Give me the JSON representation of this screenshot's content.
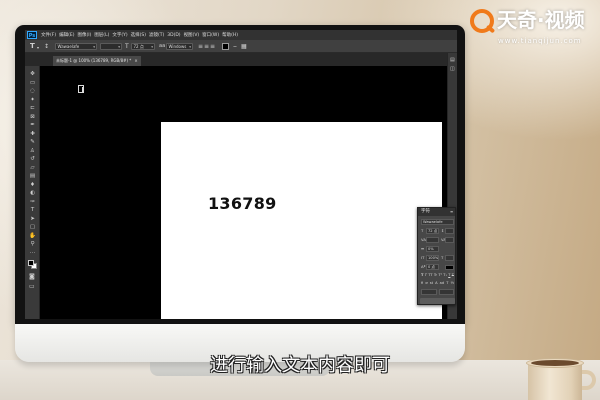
{
  "watermark": {
    "brand": "天奇·视频",
    "url": "www.tianqijun.com"
  },
  "subtitle": "进行输入文本内容即可",
  "photoshop": {
    "logo": "Ps",
    "menu": [
      "文件(F)",
      "编辑(E)",
      "图像(I)",
      "图层(L)",
      "文字(Y)",
      "选择(S)",
      "滤镜(T)",
      "3D(D)",
      "视图(V)",
      "窗口(W)",
      "帮助(H)"
    ],
    "options_bar": {
      "font_family": "Wawaelafe",
      "font_style": "",
      "font_size": "72 点",
      "antialias": "Windows",
      "text_color": "#000000"
    },
    "document_tab": {
      "title": "未标题-1 @ 100% (136789, RGB/8#) *"
    },
    "tools": [
      "move-icon",
      "marquee-icon",
      "lasso-icon",
      "quick-select-icon",
      "crop-icon",
      "frame-icon",
      "eyedropper-icon",
      "spot-healing-icon",
      "brush-icon",
      "clone-stamp-icon",
      "history-brush-icon",
      "eraser-icon",
      "gradient-icon",
      "blur-icon",
      "dodge-icon",
      "pen-icon",
      "type-icon",
      "path-selection-icon",
      "rectangle-icon",
      "hand-icon",
      "zoom-icon",
      "more-tools-icon"
    ],
    "foreground_color": "#000000",
    "background_color": "#ffffff",
    "canvas": {
      "text_layer": "136789"
    },
    "character_panel": {
      "title": "字符",
      "font_family": "Wawaelafe",
      "font_size": "72 点",
      "tsume": "0%",
      "vertical_scale": "100%",
      "baseline_shift": "0 点",
      "text_color": "#000000"
    }
  },
  "colors": {
    "brand_orange": "#f07a1a",
    "ps_blue": "#31a8ff",
    "ui_dark": "#3a3a3a"
  }
}
